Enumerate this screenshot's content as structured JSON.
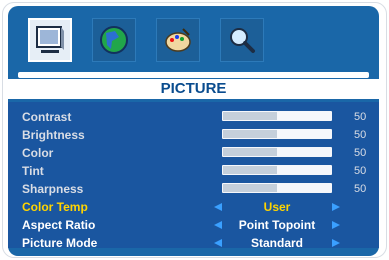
{
  "tabs": [
    {
      "icon": "monitor-icon",
      "active": true
    },
    {
      "icon": "globe-icon",
      "active": false
    },
    {
      "icon": "palette-icon",
      "active": false
    },
    {
      "icon": "magnifier-icon",
      "active": false
    }
  ],
  "title": "PICTURE",
  "sliders": [
    {
      "label": "Contrast",
      "value": "50",
      "level": 0.5
    },
    {
      "label": "Brightness",
      "value": "50",
      "level": 0.5
    },
    {
      "label": "Color",
      "value": "50",
      "level": 0.5
    },
    {
      "label": "Tint",
      "value": "50",
      "level": 0.5
    },
    {
      "label": "Sharpness",
      "value": "50",
      "level": 0.5
    }
  ],
  "options": [
    {
      "label": "Color Temp",
      "value": "User",
      "highlight": true
    },
    {
      "label": "Aspect Ratio",
      "value": "Point Topoint",
      "highlight": false
    },
    {
      "label": "Picture Mode",
      "value": "Standard",
      "highlight": false
    }
  ],
  "colors": {
    "panel": "#1a67a8",
    "highlight": "#ffd400",
    "arrow": "#3aa0ff"
  }
}
